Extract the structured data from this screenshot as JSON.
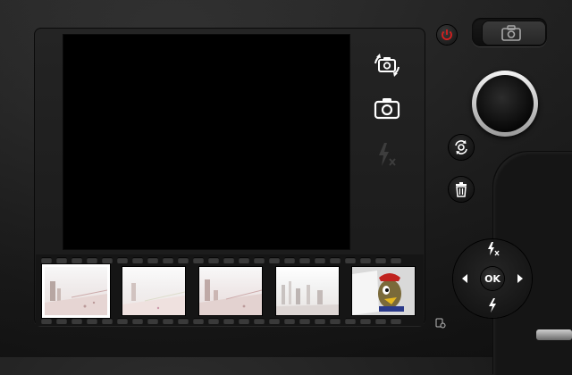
{
  "controls": {
    "switch_camera": "switch-camera-icon",
    "capture_photo": "camera-icon",
    "flash_off": "flash-off-icon",
    "rotate": "rotate-icon",
    "delete": "trash-icon",
    "power": "power-icon",
    "mode": "camera-icon",
    "shutter": "shutter-button"
  },
  "dpad": {
    "up_icon": "flash-off-icon",
    "down_icon": "flash-icon",
    "left_icon": "left-arrow-icon",
    "right_icon": "right-arrow-icon",
    "ok_label": "OK"
  },
  "filmstrip": {
    "frames": [
      {
        "selected": true
      },
      {
        "selected": false
      },
      {
        "selected": false
      },
      {
        "selected": false
      },
      {
        "selected": false
      }
    ]
  },
  "colors": {
    "power": "#d42020",
    "body": "#1c1c1c",
    "viewfinder": "#000000"
  }
}
